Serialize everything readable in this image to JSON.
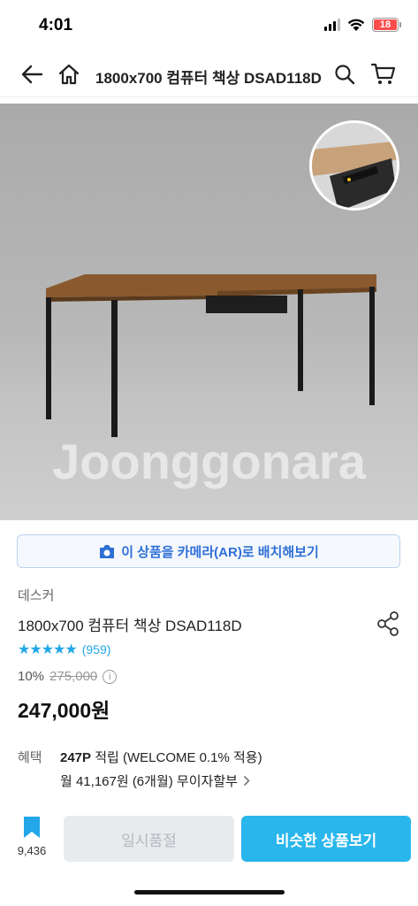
{
  "status_bar": {
    "time": "4:01",
    "battery": "18"
  },
  "header": {
    "title": "1800x700 컴퓨터 책상 DSAD118D"
  },
  "image": {
    "watermark": "Joonggonara"
  },
  "ar_button": {
    "label": "이 상품을 카메라(AR)로 배치해보기"
  },
  "product": {
    "brand": "데스커",
    "name": "1800x700 컴퓨터 책상 DSAD118D",
    "stars": "★★★★★",
    "review_count": "(959)",
    "discount_rate": "10%",
    "original_price": "275,000",
    "price": "247,000원"
  },
  "benefits": {
    "label": "혜택",
    "points": "247P",
    "points_text": "적립 (WELCOME 0.1% 적용)",
    "installment": "월 41,167원 (6개월) 무이자할부"
  },
  "bottom_bar": {
    "wishlist_count": "9,436",
    "soldout_label": "일시품절",
    "similar_label": "비슷한 상품보기"
  },
  "colors": {
    "accent": "#29b6ec",
    "link": "#2f6fd6",
    "star": "#22a7e8"
  }
}
